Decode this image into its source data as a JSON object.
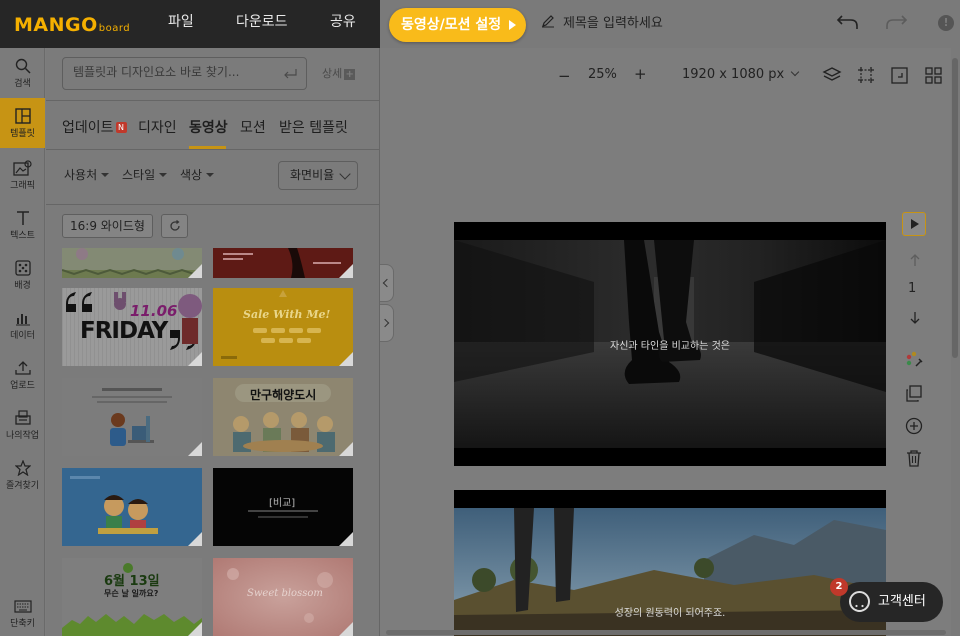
{
  "app": {
    "logo": "MANGO",
    "logo_sub": "board",
    "menu": [
      "파일",
      "다운로드",
      "공유"
    ],
    "motion_button": "동영상/모션 설정",
    "title_placeholder": "제목을 입력하세요"
  },
  "rail": [
    {
      "label": "검색",
      "icon": "search-icon"
    },
    {
      "label": "템플릿",
      "icon": "template-icon",
      "active": true
    },
    {
      "label": "그래픽",
      "icon": "graphic-icon"
    },
    {
      "label": "텍스트",
      "icon": "text-icon"
    },
    {
      "label": "배경",
      "icon": "background-icon"
    },
    {
      "label": "데이터",
      "icon": "data-icon"
    },
    {
      "label": "업로드",
      "icon": "upload-icon"
    },
    {
      "label": "나의작업",
      "icon": "my-work-icon"
    },
    {
      "label": "즐겨찾기",
      "icon": "star-icon"
    },
    {
      "label": "단축키",
      "icon": "keyboard-icon"
    }
  ],
  "panel": {
    "search_placeholder": "템플릿과 디자인요소 바로 찾기...",
    "detail_label": "상세",
    "tabs": [
      "업데이트",
      "디자인",
      "동영상",
      "모션",
      "받은 템플릿"
    ],
    "update_badge": "N",
    "filters": [
      "사용처",
      "스타일",
      "색상"
    ],
    "ratio_label": "화면비율",
    "active_chip": "16:9 와이드형",
    "thumb_texts": {
      "friday": "FRIDAY",
      "friday_num": "11.06",
      "sale": "Sale With Me!",
      "city": "만구해양도시",
      "dark": "[비교]",
      "june_top": "6월 13일",
      "june_bottom": "무슨 날 일까요?",
      "sweet": "Sweet blossom"
    }
  },
  "canvas": {
    "zoom": "25%",
    "zoom_minus": "−",
    "zoom_plus": "+",
    "size": "1920 x 1080 px",
    "page_number": "1",
    "slide1_caption": "자신과 타인을 비교하는 것은",
    "slide2_caption": "성장의 원동력이 되어주죠."
  },
  "help": {
    "label": "고객센터",
    "count": "2"
  }
}
